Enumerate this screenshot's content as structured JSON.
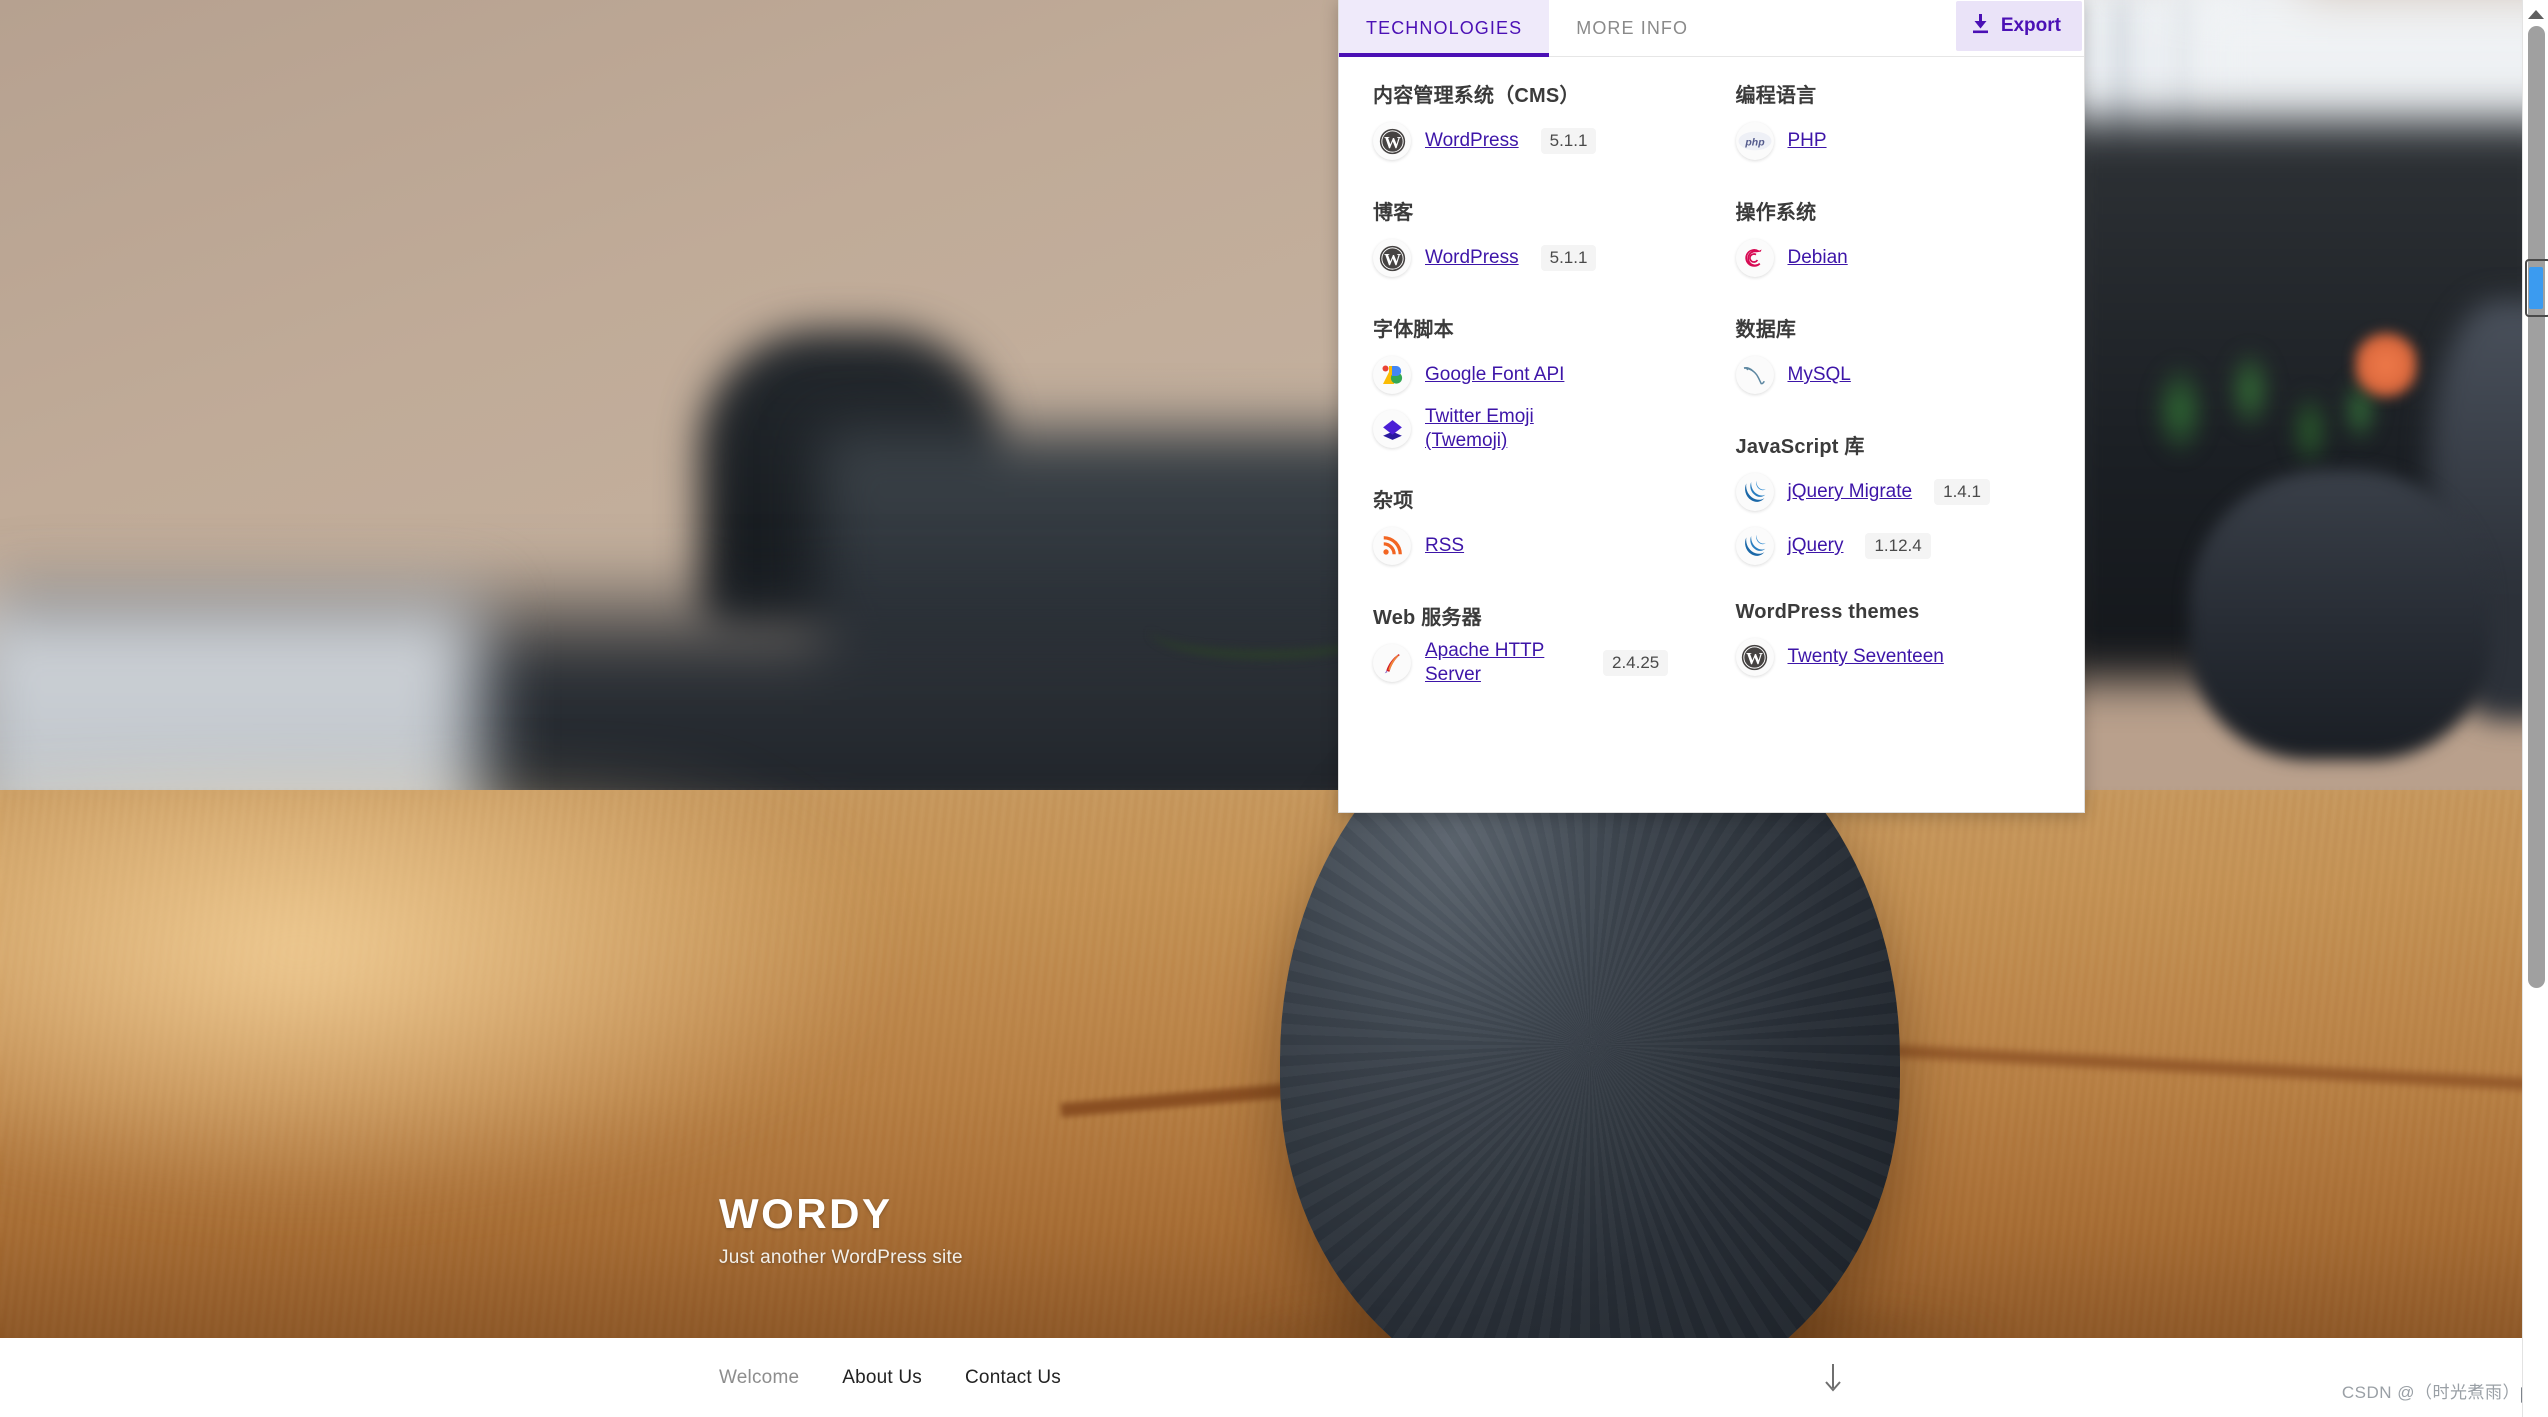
{
  "website": {
    "hero": {
      "title": "WORDY",
      "tagline": "Just another WordPress site"
    },
    "nav": {
      "items": [
        {
          "label": "Welcome",
          "state": "muted"
        },
        {
          "label": "About Us",
          "state": "normal"
        },
        {
          "label": "Contact Us",
          "state": "normal"
        }
      ],
      "scroll_arrow_icon": "arrow-down-icon"
    }
  },
  "watermark": {
    "text": "CSDN @（时光煮雨）"
  },
  "panel": {
    "tabs": [
      {
        "label": "TECHNOLOGIES",
        "active": true
      },
      {
        "label": "MORE INFO",
        "active": false
      }
    ],
    "export": {
      "label": "Export",
      "icon": "download-icon"
    },
    "accent_color": "#4b10b5",
    "tab_active_bg": "#efeafa",
    "link_color": "#3d15a8",
    "columns": [
      {
        "categories": [
          {
            "title": "内容管理系统（CMS）",
            "items": [
              {
                "name": "WordPress",
                "version": "5.1.1",
                "icon": "wordpress-icon"
              }
            ]
          },
          {
            "title": "博客",
            "items": [
              {
                "name": "WordPress",
                "version": "5.1.1",
                "icon": "wordpress-icon"
              }
            ]
          },
          {
            "title": "字体脚本",
            "items": [
              {
                "name": "Google Font API",
                "version": "",
                "icon": "google-font-icon"
              },
              {
                "name": "Twitter Emoji (Twemoji)",
                "version": "",
                "icon": "twemoji-icon"
              }
            ]
          },
          {
            "title": "杂项",
            "items": [
              {
                "name": "RSS",
                "version": "",
                "icon": "rss-icon"
              }
            ]
          },
          {
            "title": "Web 服务器",
            "items": [
              {
                "name": "Apache HTTP Server",
                "version": "2.4.25",
                "icon": "apache-icon",
                "wrap": true
              }
            ]
          }
        ]
      },
      {
        "categories": [
          {
            "title": "编程语言",
            "items": [
              {
                "name": "PHP",
                "version": "",
                "icon": "php-icon"
              }
            ]
          },
          {
            "title": "操作系统",
            "items": [
              {
                "name": "Debian",
                "version": "",
                "icon": "debian-icon"
              }
            ]
          },
          {
            "title": "数据库",
            "items": [
              {
                "name": "MySQL",
                "version": "",
                "icon": "mysql-icon"
              }
            ]
          },
          {
            "title": "JavaScript 库",
            "items": [
              {
                "name": "jQuery Migrate",
                "version": "1.4.1",
                "icon": "jquery-icon"
              },
              {
                "name": "jQuery",
                "version": "1.12.4",
                "icon": "jquery-icon"
              }
            ]
          },
          {
            "title": "WordPress themes",
            "items": [
              {
                "name": "Twenty Seventeen",
                "version": "",
                "icon": "wordpress-icon"
              }
            ]
          }
        ]
      }
    ]
  }
}
